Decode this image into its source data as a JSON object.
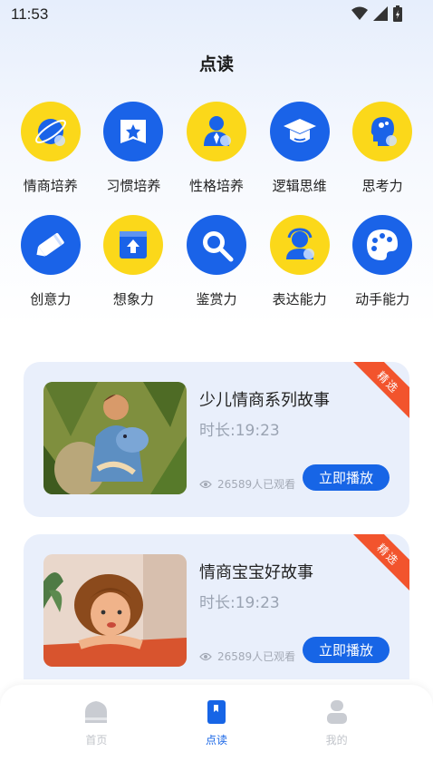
{
  "status_bar": {
    "time": "11:53"
  },
  "page": {
    "title": "点读"
  },
  "categories": [
    {
      "label": "情商培养",
      "color": "yellow",
      "icon": "planet-icon"
    },
    {
      "label": "习惯培养",
      "color": "blue",
      "icon": "star-banner-icon"
    },
    {
      "label": "性格培养",
      "color": "yellow",
      "icon": "person-tie-icon"
    },
    {
      "label": "逻辑思维",
      "color": "blue",
      "icon": "graduation-cap-icon"
    },
    {
      "label": "思考力",
      "color": "yellow",
      "icon": "brain-head-icon"
    },
    {
      "label": "创意力",
      "color": "blue",
      "icon": "pencil-icon"
    },
    {
      "label": "想象力",
      "color": "yellow",
      "icon": "upload-box-icon"
    },
    {
      "label": "鉴赏力",
      "color": "blue",
      "icon": "magnifier-icon"
    },
    {
      "label": "表达能力",
      "color": "yellow",
      "icon": "speaker-person-icon"
    },
    {
      "label": "动手能力",
      "color": "blue",
      "icon": "palette-icon"
    }
  ],
  "stories": [
    {
      "title": "少儿情商系列故事",
      "duration": "时长:19:23",
      "views": "26589人已观看",
      "play_label": "立即播放",
      "badge": "精选"
    },
    {
      "title": "情商宝宝好故事",
      "duration": "时长:19:23",
      "views": "26589人已观看",
      "play_label": "立即播放",
      "badge": "精选"
    }
  ],
  "tabbar": {
    "items": [
      {
        "label": "首页",
        "icon": "home-icon",
        "active": false
      },
      {
        "label": "点读",
        "icon": "book-icon",
        "active": true
      },
      {
        "label": "我的",
        "icon": "user-icon",
        "active": false
      }
    ]
  },
  "colors": {
    "accent": "#1765e6",
    "yellow": "#fbd81a",
    "blue": "#1a63e8",
    "badge": "#f2542d"
  }
}
